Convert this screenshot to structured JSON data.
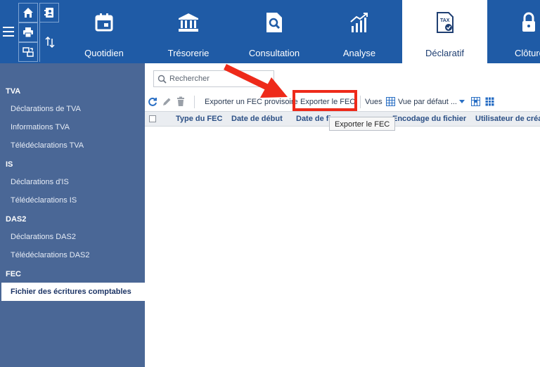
{
  "nav": {
    "tabs": [
      {
        "label": "Quotidien"
      },
      {
        "label": "Trésorerie"
      },
      {
        "label": "Consultation"
      },
      {
        "label": "Analyse"
      },
      {
        "label": "Déclaratif",
        "active": true
      },
      {
        "label": "Clôture"
      }
    ],
    "tax_icon_text": "TAX"
  },
  "sidebar": {
    "sections": [
      {
        "title": "TVA",
        "items": [
          "Déclarations de TVA",
          "Informations TVA",
          "Télédéclarations TVA"
        ]
      },
      {
        "title": "IS",
        "items": [
          "Déclarations d'IS",
          "Télédéclarations IS"
        ]
      },
      {
        "title": "DAS2",
        "items": [
          "Déclarations DAS2",
          "Télédéclarations DAS2"
        ]
      },
      {
        "title": "FEC",
        "items": [
          "Fichier des écritures comptables"
        ]
      }
    ]
  },
  "search": {
    "placeholder": "Rechercher"
  },
  "toolbar": {
    "export_provisional": "Exporter un FEC provisoire",
    "export_fec": "Exporter le FEC",
    "views_label": "Vues",
    "default_view": "Vue par défaut ..."
  },
  "grid": {
    "columns": [
      "Type du FEC",
      "Date de début",
      "Date de fin",
      "Encodage du fichier",
      "Utilisateur de création"
    ]
  },
  "tooltip": {
    "text": "Exporter le FEC"
  },
  "colors": {
    "brand_blue": "#1f5ba6",
    "sidebar": "#4a6796",
    "annotation_red": "#ee2a1a"
  }
}
